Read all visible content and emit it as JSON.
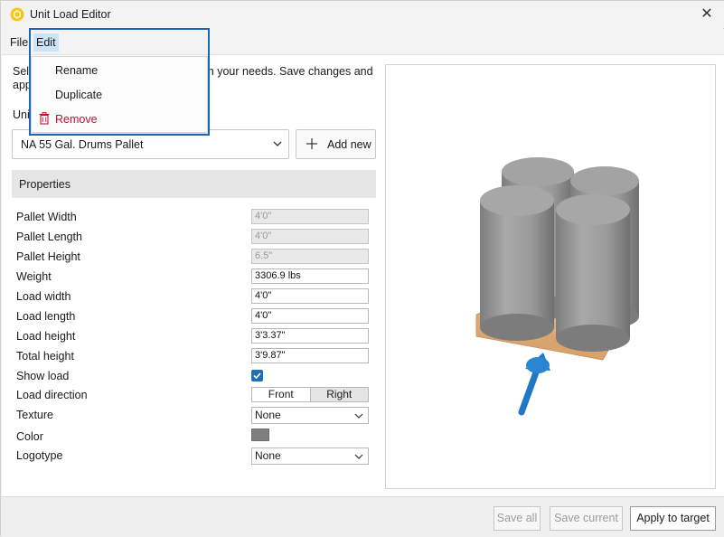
{
  "window": {
    "title": "Unit Load Editor"
  },
  "menu": {
    "file": "File",
    "edit": "Edit"
  },
  "edit_menu": {
    "rename": "Rename",
    "duplicate": "Duplicate",
    "remove": "Remove"
  },
  "intro": {
    "line1_start": "Sel",
    "line1_end": "tch your needs. Save changes and",
    "line2_start": "app"
  },
  "unit_load": {
    "label_partial": "Uni",
    "selected": "NA 55 Gal. Drums Pallet",
    "add_new_label": "Add new"
  },
  "properties": {
    "header": "Properties",
    "pallet_width": {
      "label": "Pallet Width",
      "value": "4'0\""
    },
    "pallet_length": {
      "label": "Pallet Length",
      "value": "4'0\""
    },
    "pallet_height": {
      "label": "Pallet Height",
      "value": "6.5\""
    },
    "weight": {
      "label": "Weight",
      "value": "3306.9 lbs"
    },
    "load_width": {
      "label": "Load width",
      "value": "4'0\""
    },
    "load_length": {
      "label": "Load length",
      "value": "4'0\""
    },
    "load_height": {
      "label": "Load height",
      "value": "3'3.37\""
    },
    "total_height": {
      "label": "Total height",
      "value": "3'9.87\""
    },
    "show_load": {
      "label": "Show load",
      "checked": true
    },
    "load_direction": {
      "label": "Load direction",
      "front": "Front",
      "right": "Right",
      "selected": "Front"
    },
    "texture": {
      "label": "Texture",
      "value": "None"
    },
    "color": {
      "label": "Color",
      "value": "#808080"
    },
    "logotype": {
      "label": "Logotype",
      "value": "None"
    }
  },
  "footer": {
    "save_all": "Save all",
    "save_current": "Save current",
    "apply_to_target": "Apply to target"
  },
  "colors": {
    "accent": "#1f6fb5",
    "highlight": "#1c66b3",
    "remove": "#c8102e",
    "drum": "#9a9a9a",
    "pallet": "#e2b88a",
    "arrow": "#1f78c4"
  }
}
